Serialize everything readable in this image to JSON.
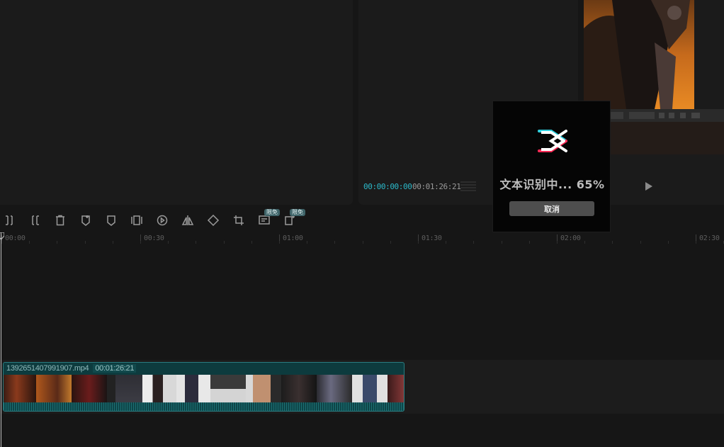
{
  "player": {
    "current_time": "00:00:00:00",
    "total_time": "00:01:26:21"
  },
  "toolbar": {
    "tools": [
      {
        "name": "split-left-icon"
      },
      {
        "name": "split-right-icon"
      },
      {
        "name": "delete-icon"
      },
      {
        "name": "marker-add-icon"
      },
      {
        "name": "marker-icon"
      },
      {
        "name": "freeze-frame-icon"
      },
      {
        "name": "reverse-play-icon"
      },
      {
        "name": "mirror-icon"
      },
      {
        "name": "rotate-icon"
      },
      {
        "name": "crop-icon"
      },
      {
        "name": "auto-caption-icon",
        "badge": "限免"
      },
      {
        "name": "ai-effect-icon",
        "badge": "限免"
      }
    ]
  },
  "ruler": {
    "labels": [
      "00:00",
      "00:30",
      "01:00",
      "01:30",
      "02:00",
      "02:30"
    ]
  },
  "clip": {
    "filename": "1392651407991907.mp4",
    "duration": "00:01:26:21"
  },
  "dialog": {
    "progress_text": "文本识别中... 65%",
    "progress_percent": 65,
    "cancel_label": "取消"
  },
  "colors": {
    "accent": "#2bb8c9",
    "clip_fill": "#0d3b3e",
    "clip_border": "#2a7c80",
    "badge": "#3f6469"
  }
}
